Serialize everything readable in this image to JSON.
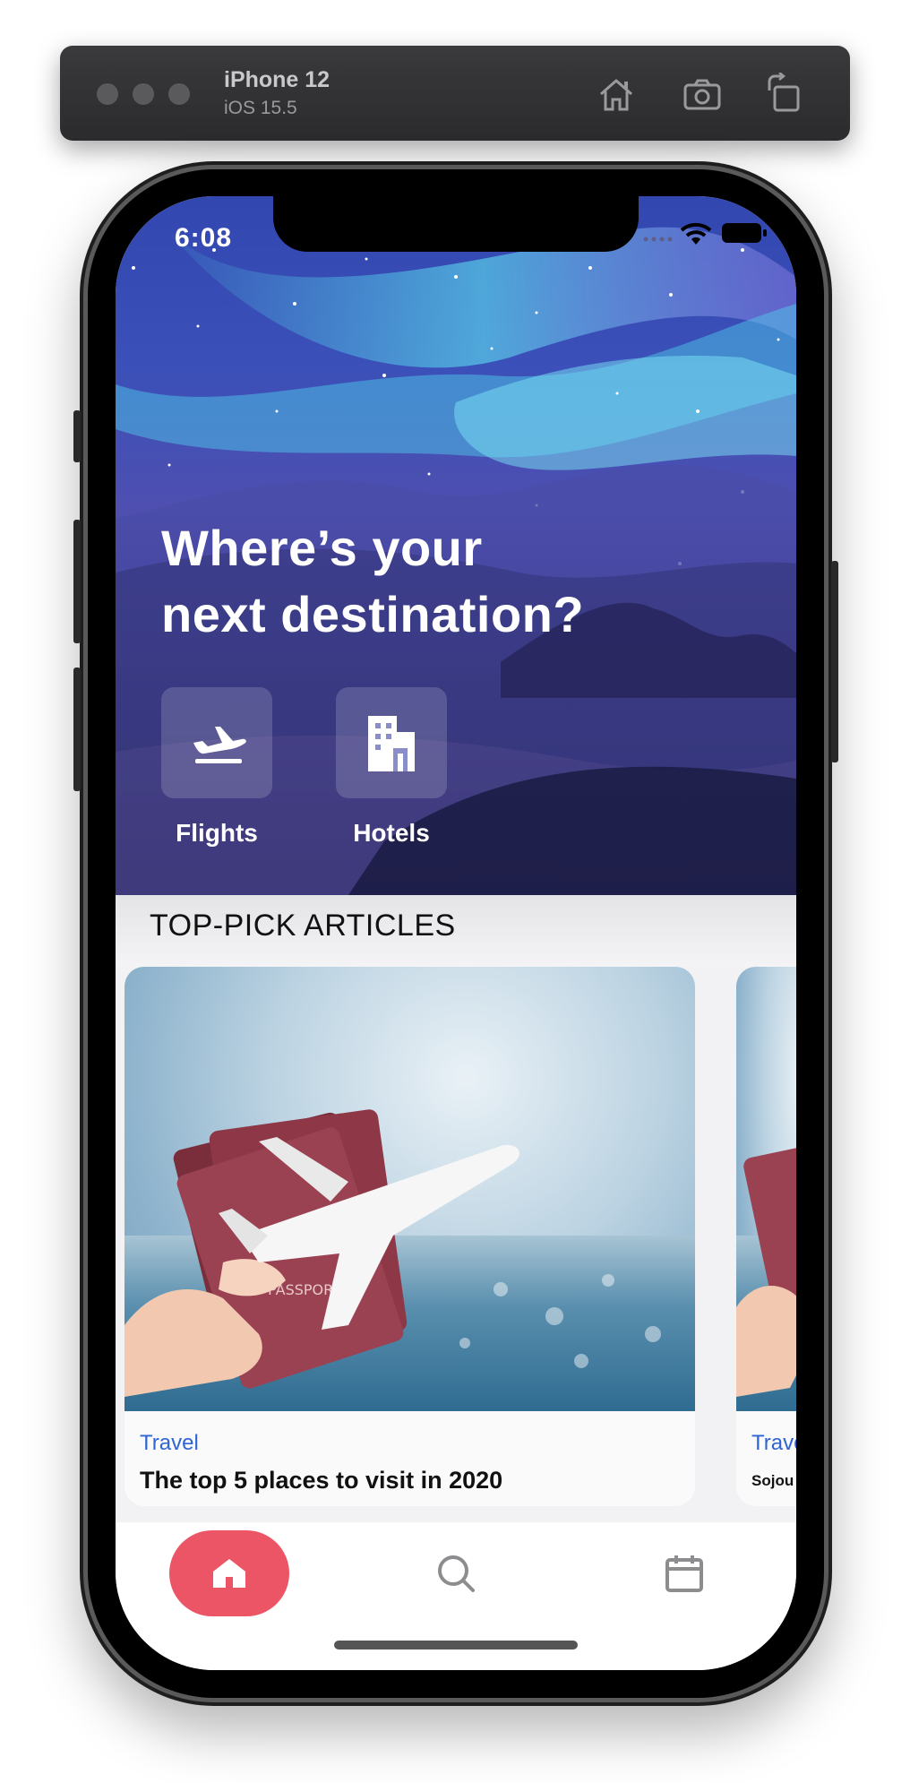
{
  "simulator": {
    "device": "iPhone 12",
    "os": "iOS 15.5",
    "toolbar_icons": [
      "home-icon",
      "screenshot-icon",
      "rotate-icon"
    ]
  },
  "status_bar": {
    "time": "6:08",
    "icons": [
      "signal-icon",
      "wifi-icon",
      "battery-icon"
    ]
  },
  "hero": {
    "headline_line1": "Where’s your",
    "headline_line2": "next destination?",
    "categories": [
      {
        "label": "Flights",
        "icon": "airplane-icon"
      },
      {
        "label": "Hotels",
        "icon": "building-icon"
      }
    ]
  },
  "articles": {
    "section_title": "TOP-PICK ARTICLES",
    "items": [
      {
        "category": "Travel",
        "title": "The top 5 places to visit in 2020",
        "image": "passport-airplane-photo"
      },
      {
        "category": "Trave",
        "title": "Sojou",
        "image": "passport-airplane-photo"
      }
    ]
  },
  "tab_bar": {
    "tabs": [
      {
        "name": "home",
        "icon": "house-icon",
        "active": true
      },
      {
        "name": "search",
        "icon": "search-icon",
        "active": false
      },
      {
        "name": "calendar",
        "icon": "calendar-icon",
        "active": false
      }
    ],
    "active_color": "#ec5566"
  }
}
